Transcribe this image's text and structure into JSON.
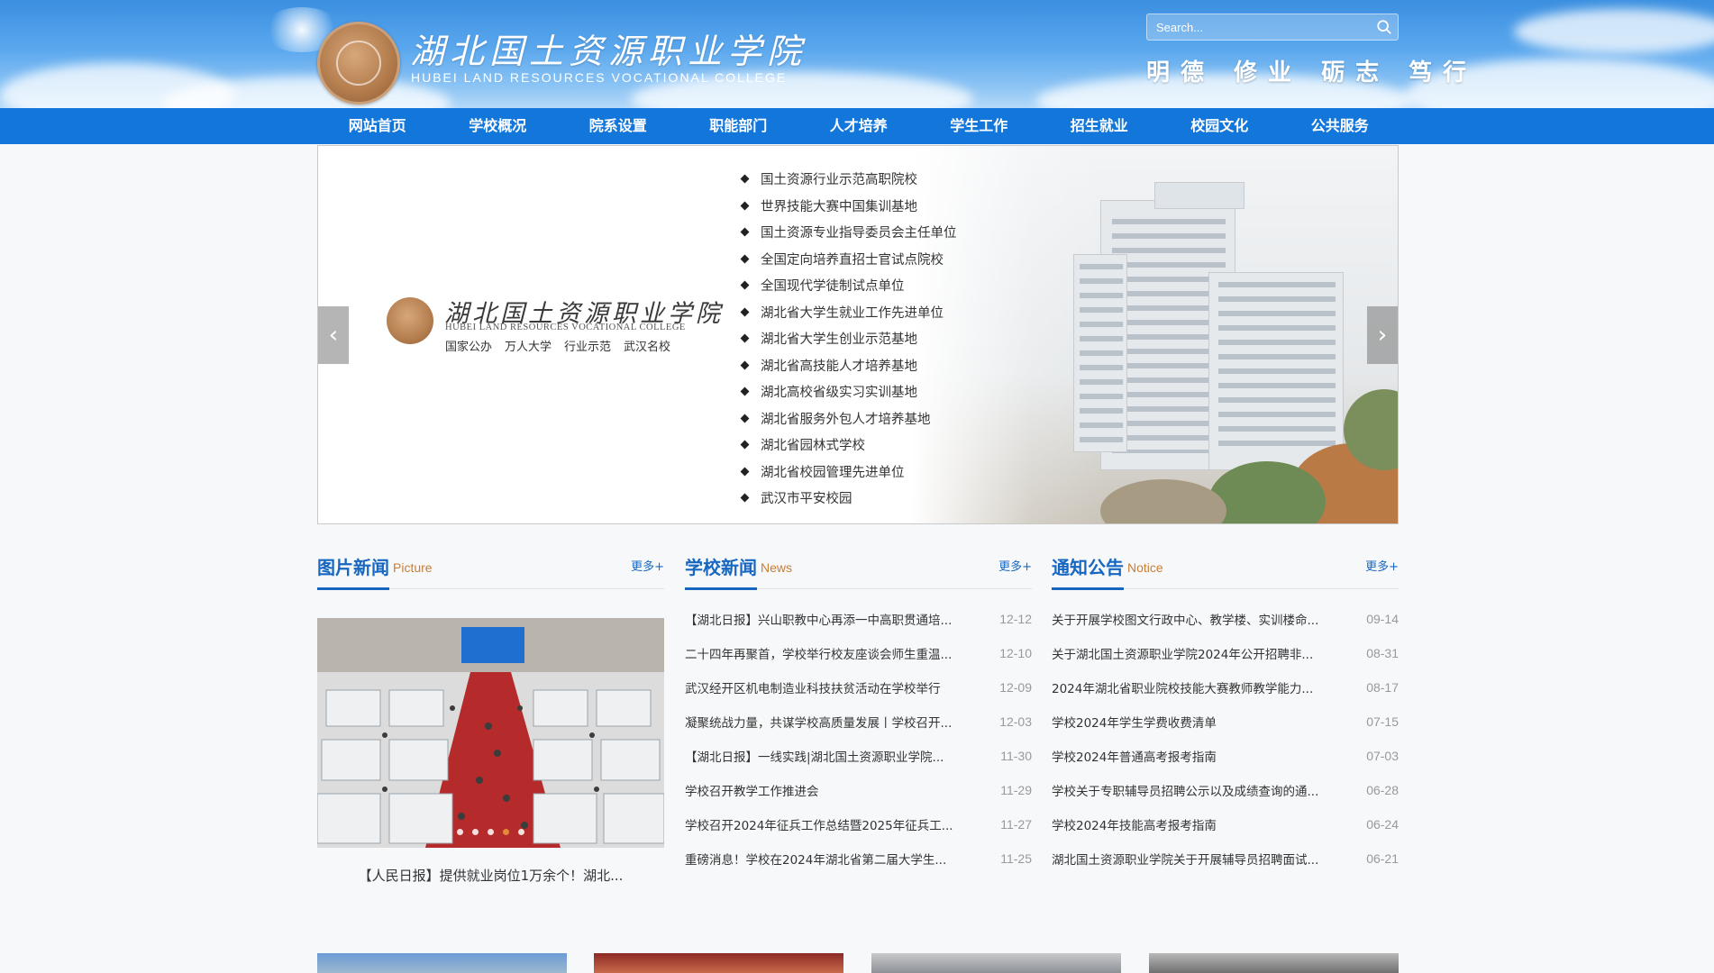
{
  "header": {
    "logo_title": "湖北国土资源职业学院",
    "logo_subtitle": "HUBEI LAND RESOURCES VOCATIONAL COLLEGE",
    "search_placeholder": "Search...",
    "motto": "明德 修业 砺志 笃行"
  },
  "nav": {
    "items": [
      "网站首页",
      "学校概况",
      "院系设置",
      "职能部门",
      "人才培养",
      "学生工作",
      "招生就业",
      "校园文化",
      "公共服务"
    ]
  },
  "banner": {
    "logo_title": "湖北国土资源职业学院",
    "logo_subtitle": "HUBEI LAND RESOURCES VOCATIONAL COLLEGE",
    "tags": [
      "国家公办",
      "万人大学",
      "行业示范",
      "武汉名校"
    ],
    "honors": [
      "国土资源行业示范高职院校",
      "世界技能大赛中国集训基地",
      "国土资源专业指导委员会主任单位",
      "全国定向培养直招士官试点院校",
      "全国现代学徒制试点单位",
      "湖北省大学生就业工作先进单位",
      "湖北省大学生创业示范基地",
      "湖北省高技能人才培养基地",
      "湖北高校省级实习实训基地",
      "湖北省服务外包人才培养基地",
      "湖北省园林式学校",
      "湖北省校园管理先进单位",
      "武汉市平安校园"
    ],
    "prev_arrow": "‹",
    "next_arrow": "›"
  },
  "picture_news": {
    "title_cn": "图片新闻",
    "title_en": "Picture",
    "more": "更多+",
    "caption": "【人民日报】提供就业岗位1万余个！湖北..."
  },
  "school_news": {
    "title_cn": "学校新闻",
    "title_en": "News",
    "more": "更多+",
    "items": [
      {
        "title": "【湖北日报】兴山职教中心再添一中高职贯通培...",
        "date": "12-12"
      },
      {
        "title": "二十四年再聚首，学校举行校友座谈会师生重温...",
        "date": "12-10"
      },
      {
        "title": "武汉经开区机电制造业科技扶贫活动在学校举行",
        "date": "12-09"
      },
      {
        "title": "凝聚统战力量，共谋学校高质量发展丨学校召开...",
        "date": "12-03"
      },
      {
        "title": "【湖北日报】一线实践|湖北国土资源职业学院...",
        "date": "11-30"
      },
      {
        "title": "学校召开教学工作推进会",
        "date": "11-29"
      },
      {
        "title": "学校召开2024年征兵工作总结暨2025年征兵工...",
        "date": "11-27"
      },
      {
        "title": "重磅消息！学校在2024年湖北省第二届大学生...",
        "date": "11-25"
      }
    ]
  },
  "notices": {
    "title_cn": "通知公告",
    "title_en": "Notice",
    "more": "更多+",
    "items": [
      {
        "title": "关于开展学校图文行政中心、教学楼、实训楼命...",
        "date": "09-14"
      },
      {
        "title": "关于湖北国土资源职业学院2024年公开招聘非...",
        "date": "08-31"
      },
      {
        "title": "2024年湖北省职业院校技能大赛教师教学能力...",
        "date": "08-17"
      },
      {
        "title": "学校2024年学生学费收费清单",
        "date": "07-15"
      },
      {
        "title": "学校2024年普通高考报考指南",
        "date": "07-03"
      },
      {
        "title": "学校关于专职辅导员招聘公示以及成绩查询的通...",
        "date": "06-28"
      },
      {
        "title": "学校2024年技能高考报考指南",
        "date": "06-24"
      },
      {
        "title": "湖北国土资源职业学院关于开展辅导员招聘面试...",
        "date": "06-21"
      }
    ]
  },
  "colors": {
    "nav_bg": "#1276db",
    "title_blue": "#1767c1",
    "title_en_orange": "#c87e36",
    "dot_active": "#e28a35"
  }
}
